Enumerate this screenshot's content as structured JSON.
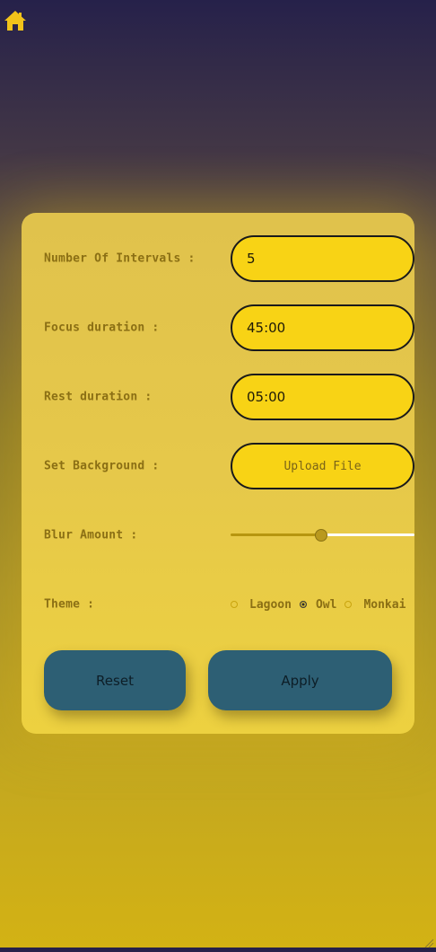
{
  "nav": {
    "home_icon": "home-icon",
    "icon_color": "#f2c31a"
  },
  "settings": {
    "intervals": {
      "label": "Number Of Intervals :",
      "value": "5"
    },
    "focus": {
      "label": "Focus duration :",
      "value": "45:00"
    },
    "rest": {
      "label": "Rest duration :",
      "value": "05:00"
    },
    "background": {
      "label": "Set Background :",
      "button_label": "Upload File"
    },
    "blur": {
      "label": "Blur Amount :",
      "value_fraction": 0.49
    },
    "theme": {
      "label": "Theme :",
      "options": [
        "Lagoon",
        "Owl",
        "Monkai"
      ],
      "selected": "Owl"
    }
  },
  "actions": {
    "reset_label": "Reset",
    "apply_label": "Apply"
  },
  "colors": {
    "field_bg": "#f8d315",
    "button_bg": "#2d5f74",
    "label": "#8b6f14"
  }
}
